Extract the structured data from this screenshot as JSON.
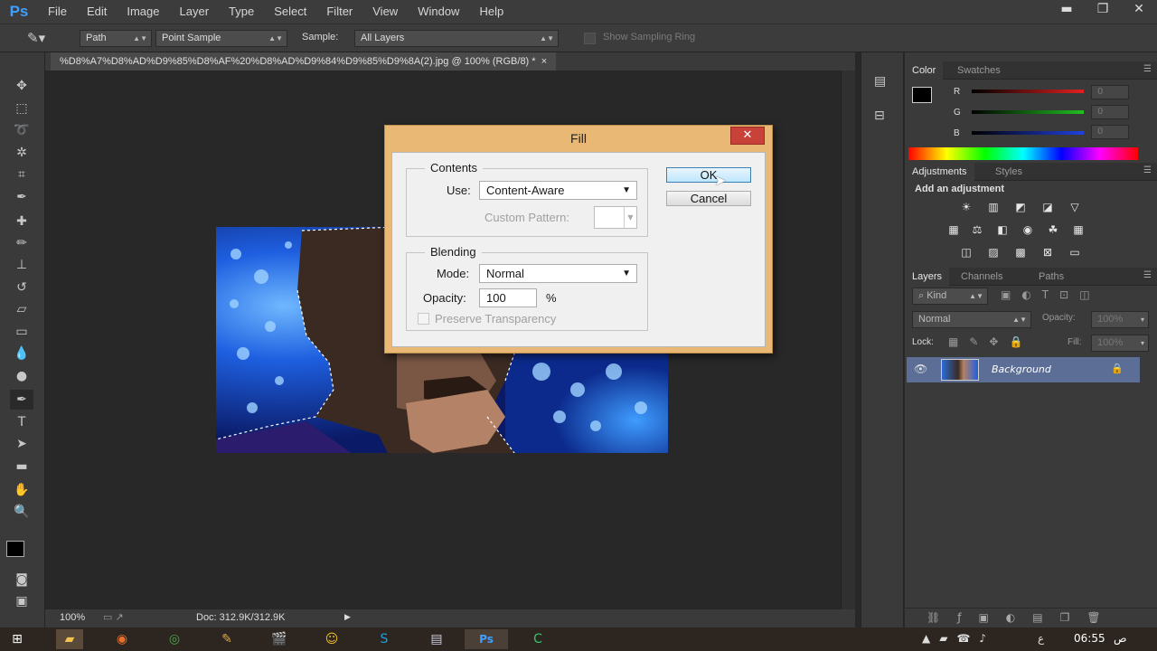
{
  "app": {
    "logo": "Ps"
  },
  "menu": [
    "File",
    "Edit",
    "Image",
    "Layer",
    "Type",
    "Select",
    "Filter",
    "View",
    "Window",
    "Help"
  ],
  "window_controls": {
    "minimize": "▬",
    "restore": "❐",
    "close": "✕"
  },
  "options": {
    "mode": "Path",
    "sample_size": "Point Sample",
    "sample_label": "Sample:",
    "sample_value": "All Layers",
    "sampling_ring": "Show Sampling Ring"
  },
  "document": {
    "tab_title": "%D8%A7%D8%AD%D9%85%D8%AF%20%D8%AD%D9%84%D9%85%D9%8A(2).jpg @ 100% (RGB/8) *",
    "tab_close": "×",
    "zoom": "100%",
    "doc_size": "Doc: 312.9K/312.9K"
  },
  "color_panel": {
    "tabs": [
      "Color",
      "Swatches"
    ],
    "channels": [
      {
        "label": "R",
        "value": "0",
        "color": "#e02020"
      },
      {
        "label": "G",
        "value": "0",
        "color": "#20c020"
      },
      {
        "label": "B",
        "value": "0",
        "color": "#2040e0"
      }
    ]
  },
  "adjustments_panel": {
    "tabs": [
      "Adjustments",
      "Styles"
    ],
    "heading": "Add an adjustment"
  },
  "layers_panel": {
    "tabs": [
      "Layers",
      "Channels",
      "Paths"
    ],
    "filter": "Kind",
    "blend_mode": "Normal",
    "opacity_label": "Opacity:",
    "opacity_value": "100%",
    "lock_label": "Lock:",
    "fill_label": "Fill:",
    "fill_value": "100%",
    "layers": [
      {
        "name": "Background"
      }
    ]
  },
  "fill_dialog": {
    "title": "Fill",
    "close": "✕",
    "contents_label": "Contents",
    "use_label": "Use:",
    "use_value": "Content-Aware",
    "custom_pattern_label": "Custom Pattern:",
    "blending_label": "Blending",
    "mode_label": "Mode:",
    "mode_value": "Normal",
    "opacity_label": "Opacity:",
    "opacity_value": "100",
    "opacity_unit": "%",
    "preserve_transparency": "Preserve Transparency",
    "ok": "OK",
    "cancel": "Cancel"
  },
  "taskbar": {
    "time": "06:55",
    "ampm": "ص",
    "lang": "ع"
  },
  "colors": {
    "dialog_frame": "#e9b874",
    "accent": "#3fa0ff",
    "layer_selected": "#5c6e96"
  }
}
